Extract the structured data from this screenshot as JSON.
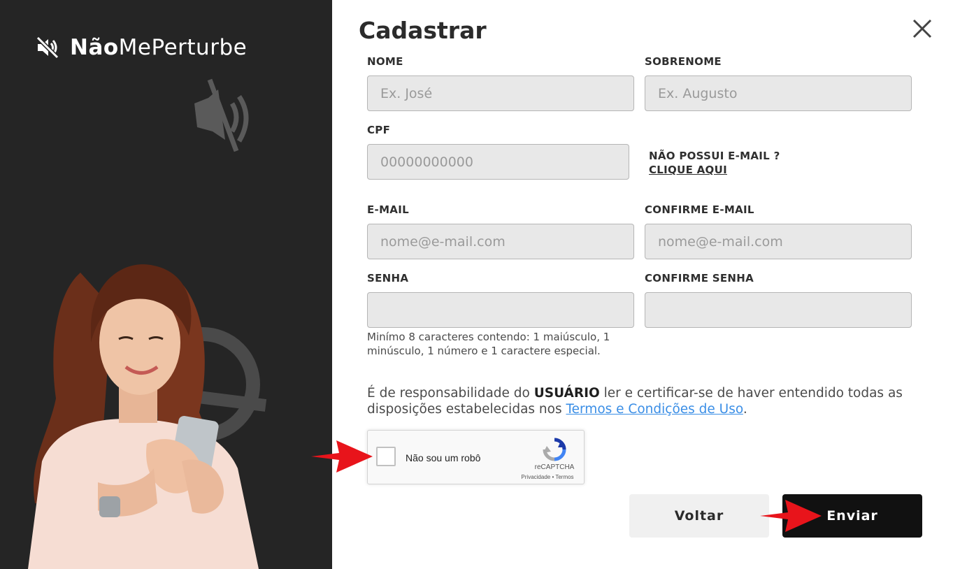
{
  "brand": {
    "bold": "Não",
    "rest": "MePerturbe"
  },
  "form": {
    "title": "Cadastrar",
    "fields": {
      "nome": {
        "label": "NOME",
        "placeholder": "Ex. José"
      },
      "sobrenome": {
        "label": "SOBRENOME",
        "placeholder": "Ex. Augusto"
      },
      "cpf": {
        "label": "CPF",
        "placeholder": "00000000000"
      },
      "email": {
        "label": "E-MAIL",
        "placeholder": "nome@e-mail.com"
      },
      "confirm_email": {
        "label": "CONFIRME E-MAIL",
        "placeholder": "nome@e-mail.com"
      },
      "senha": {
        "label": "SENHA",
        "placeholder": ""
      },
      "confirm_senha": {
        "label": "CONFIRME SENHA",
        "placeholder": ""
      }
    },
    "no_email": {
      "question": "NÃO POSSUI E-MAIL ?",
      "link": "CLIQUE AQUI"
    },
    "password_hint": "Minímo 8 caracteres contendo: 1 maiúsculo, 1 minúsculo, 1 número e 1 caractere especial.",
    "terms": {
      "prefix": "É de responsabilidade do ",
      "strong": "USUÁRIO",
      "middle": " ler e certificar-se de haver entendido todas as disposições estabelecidas nos ",
      "link": "Termos e Condições de Uso",
      "suffix": "."
    },
    "captcha": {
      "label": "Não sou um robô",
      "brand": "reCAPTCHA",
      "links": "Privacidade • Termos"
    },
    "buttons": {
      "back": "Voltar",
      "send": "Enviar"
    }
  },
  "colors": {
    "left_panel": "#252525",
    "input_bg": "#e8e8e8",
    "link": "#3a8ee6",
    "send_bg": "#111111",
    "arrow": "#e8141b"
  }
}
